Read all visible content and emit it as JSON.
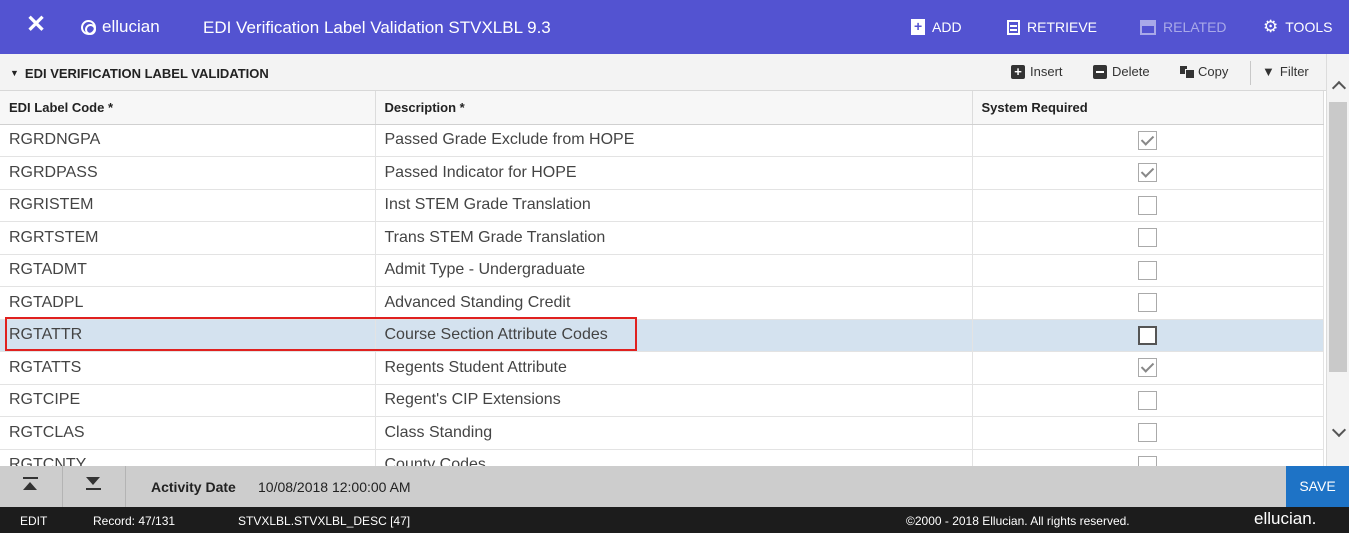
{
  "topbar": {
    "brand": "ellucian",
    "title": "EDI Verification Label Validation STVXLBL 9.3",
    "add": "ADD",
    "retrieve": "RETRIEVE",
    "related": "RELATED",
    "tools": "TOOLS",
    "colors": {
      "background": "#5353d1",
      "disabled": "#a9a9e8"
    }
  },
  "section": {
    "title": "EDI VERIFICATION LABEL VALIDATION",
    "insert": "Insert",
    "delete": "Delete",
    "copy": "Copy",
    "filter": "Filter"
  },
  "grid": {
    "columns": [
      "EDI Label Code *",
      "Description *",
      "System Required"
    ],
    "rows": [
      {
        "code": "RGRDNGPA",
        "description": "Passed Grade Exclude from HOPE",
        "system_required": true
      },
      {
        "code": "RGRDPASS",
        "description": "Passed Indicator for HOPE",
        "system_required": true
      },
      {
        "code": "RGRISTEM",
        "description": "Inst STEM Grade Translation",
        "system_required": false
      },
      {
        "code": "RGRTSTEM",
        "description": "Trans STEM Grade Translation",
        "system_required": false
      },
      {
        "code": "RGTADMT",
        "description": "Admit Type - Undergraduate",
        "system_required": false
      },
      {
        "code": "RGTADPL",
        "description": "Advanced Standing Credit",
        "system_required": false
      },
      {
        "code": "RGTATTR",
        "description": "Course Section Attribute Codes",
        "system_required": false,
        "selected": true
      },
      {
        "code": "RGTATTS",
        "description": "Regents Student Attribute",
        "system_required": true
      },
      {
        "code": "RGTCIPE",
        "description": "Regent's CIP Extensions",
        "system_required": false
      },
      {
        "code": "RGTCLAS",
        "description": "Class Standing",
        "system_required": false
      },
      {
        "code": "RGTCNTY",
        "description": "County Codes",
        "system_required": false
      }
    ],
    "colors": {
      "selected_row": "#d4e2ef",
      "highlight_box": "#e0211f"
    }
  },
  "infobar": {
    "activity_label": "Activity Date",
    "activity_value": "10/08/2018 12:00:00 AM",
    "save": "SAVE",
    "save_color": "#1e73c6"
  },
  "status": {
    "mode": "EDIT",
    "record": "Record: 47/131",
    "field": "STVXLBL.STVXLBL_DESC [47]",
    "copyright": "©2000 - 2018 Ellucian. All rights reserved.",
    "logo": "ellucian."
  }
}
